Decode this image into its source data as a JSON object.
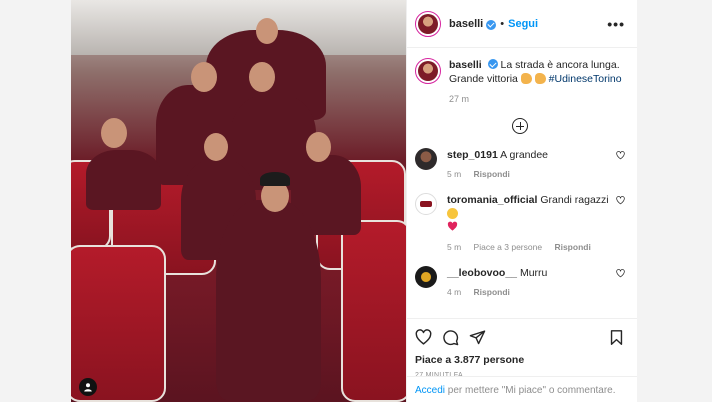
{
  "post": {
    "username": "baselli",
    "follow_label": "Segui",
    "separator": "•",
    "more_label": "•••"
  },
  "caption": {
    "username": "baselli",
    "text": "La strada è ancora lunga. Grande vittoria",
    "hashtag": "#UdineseTorino",
    "time": "27 m"
  },
  "comments": [
    {
      "username": "step_0191",
      "text": "A grandee",
      "time": "5 m",
      "reply": "Rispondi",
      "likes": ""
    },
    {
      "username": "toromania_official",
      "text": "Grandi ragazzi",
      "time": "5 m",
      "likes": "Piace a 3 persone",
      "reply": "Rispondi"
    },
    {
      "username": "__leobovoo__",
      "text": "Murru",
      "time": "4 m",
      "reply": "Rispondi",
      "likes": ""
    }
  ],
  "likes_text": "Piace a 3.877 persone",
  "timestamp": "27 MINUTI FA",
  "login": {
    "link": "Accedi",
    "text": " per mettere \"Mi piace\" o commentare."
  },
  "icons": {
    "like": "heart-icon",
    "comment": "comment-icon",
    "share": "share-icon",
    "save": "bookmark-icon",
    "load_more": "plus-circle-icon",
    "verified": "verified-badge-icon",
    "tagged_user": "user-tag-icon"
  },
  "colors": {
    "link_blue": "#0095f6",
    "hashtag": "#00376b",
    "muted": "#8e8e8e",
    "verified": "#3897f0",
    "photo_seat_red": "#8a1320"
  }
}
